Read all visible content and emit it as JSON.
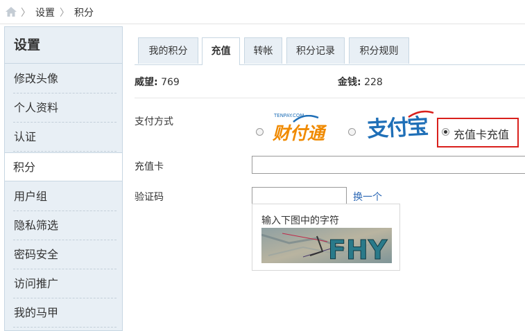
{
  "breadcrumb": {
    "home_icon": "home-icon",
    "separator": "〉",
    "items": [
      "设置",
      "积分"
    ]
  },
  "sidebar": {
    "title": "设置",
    "items": [
      {
        "label": "修改头像",
        "active": false
      },
      {
        "label": "个人资料",
        "active": false
      },
      {
        "label": "认证",
        "active": false
      },
      {
        "label": "积分",
        "active": true
      },
      {
        "label": "用户组",
        "active": false
      },
      {
        "label": "隐私筛选",
        "active": false
      },
      {
        "label": "密码安全",
        "active": false
      },
      {
        "label": "访问推广",
        "active": false
      },
      {
        "label": "我的马甲",
        "active": false
      }
    ]
  },
  "tabs": [
    {
      "label": "我的积分",
      "active": false
    },
    {
      "label": "充值",
      "active": true
    },
    {
      "label": "转帐",
      "active": false
    },
    {
      "label": "积分记录",
      "active": false
    },
    {
      "label": "积分规则",
      "active": false
    }
  ],
  "stats": {
    "prestige_label": "威望:",
    "prestige_value": "769",
    "money_label": "金钱:",
    "money_value": "228"
  },
  "payment": {
    "label": "支付方式",
    "tenpay_logo_text": "财付通",
    "tenpay_small_text": "TENPAY.COM",
    "alipay_logo_text": "支付宝",
    "card_option_label": "充值卡充值",
    "selected": "card"
  },
  "card": {
    "label": "充值卡",
    "value": ""
  },
  "captcha": {
    "label": "验证码",
    "value": "",
    "refresh_link": "换一个",
    "hint": "输入下图中的字符",
    "image_text": "FHY"
  },
  "colors": {
    "sidebar_bg": "#e8eff5",
    "border": "#c7d6e2",
    "link": "#2a66b4",
    "highlight_red": "#d9201c",
    "tenpay_orange": "#f08a00",
    "alipay_blue": "#1f6fb7"
  }
}
